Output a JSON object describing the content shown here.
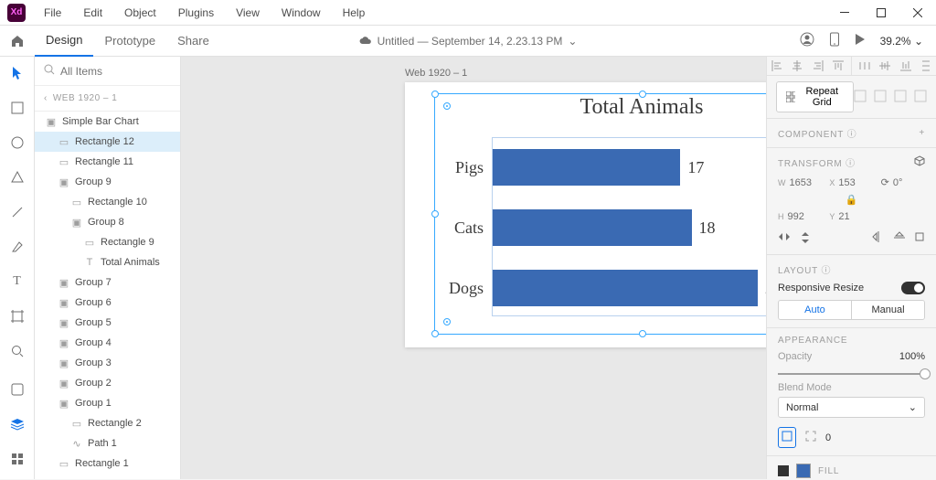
{
  "menu": [
    "File",
    "Edit",
    "Object",
    "Plugins",
    "View",
    "Window",
    "Help"
  ],
  "tabs": {
    "design": "Design",
    "prototype": "Prototype",
    "share": "Share"
  },
  "doc_title": "Untitled — September 14, 2.23.13 PM",
  "zoom": "39.2%",
  "search_placeholder": "All Items",
  "breadcrumb": "WEB 1920 – 1",
  "layers": [
    {
      "label": "Simple Bar Chart",
      "indent": 0,
      "type": "artboard"
    },
    {
      "label": "Rectangle 12",
      "indent": 1,
      "type": "rect",
      "selected": true
    },
    {
      "label": "Rectangle 11",
      "indent": 1,
      "type": "rect"
    },
    {
      "label": "Group 9",
      "indent": 1,
      "type": "group"
    },
    {
      "label": "Rectangle 10",
      "indent": 2,
      "type": "rect"
    },
    {
      "label": "Group 8",
      "indent": 2,
      "type": "group"
    },
    {
      "label": "Rectangle 9",
      "indent": 3,
      "type": "rect"
    },
    {
      "label": "Total Animals",
      "indent": 3,
      "type": "text"
    },
    {
      "label": "Group 7",
      "indent": 1,
      "type": "group"
    },
    {
      "label": "Group 6",
      "indent": 1,
      "type": "group"
    },
    {
      "label": "Group 5",
      "indent": 1,
      "type": "group"
    },
    {
      "label": "Group 4",
      "indent": 1,
      "type": "group"
    },
    {
      "label": "Group 3",
      "indent": 1,
      "type": "group"
    },
    {
      "label": "Group 2",
      "indent": 1,
      "type": "group"
    },
    {
      "label": "Group 1",
      "indent": 1,
      "type": "group"
    },
    {
      "label": "Rectangle 2",
      "indent": 2,
      "type": "rect"
    },
    {
      "label": "Path 1",
      "indent": 2,
      "type": "path"
    },
    {
      "label": "Rectangle 1",
      "indent": 1,
      "type": "rect"
    }
  ],
  "artboard_label": "Web 1920 – 1",
  "chart_data": {
    "type": "bar",
    "title": "Total Animals",
    "categories": [
      "Pigs",
      "Cats",
      "Dogs"
    ],
    "values": [
      17,
      18,
      24
    ],
    "xlabel": "",
    "ylabel": ""
  },
  "props": {
    "repeat_grid": "Repeat Grid",
    "component": "COMPONENT",
    "transform": "TRANSFORM",
    "w": "1653",
    "x": "153",
    "rotation": "0°",
    "h": "992",
    "y": "21",
    "layout": "LAYOUT",
    "responsive": "Responsive Resize",
    "auto": "Auto",
    "manual": "Manual",
    "appearance": "APPEARANCE",
    "opacity_label": "Opacity",
    "opacity_value": "100%",
    "blend_label": "Blend Mode",
    "blend_value": "Normal",
    "corner_radius": "0",
    "fill": "FILL"
  }
}
